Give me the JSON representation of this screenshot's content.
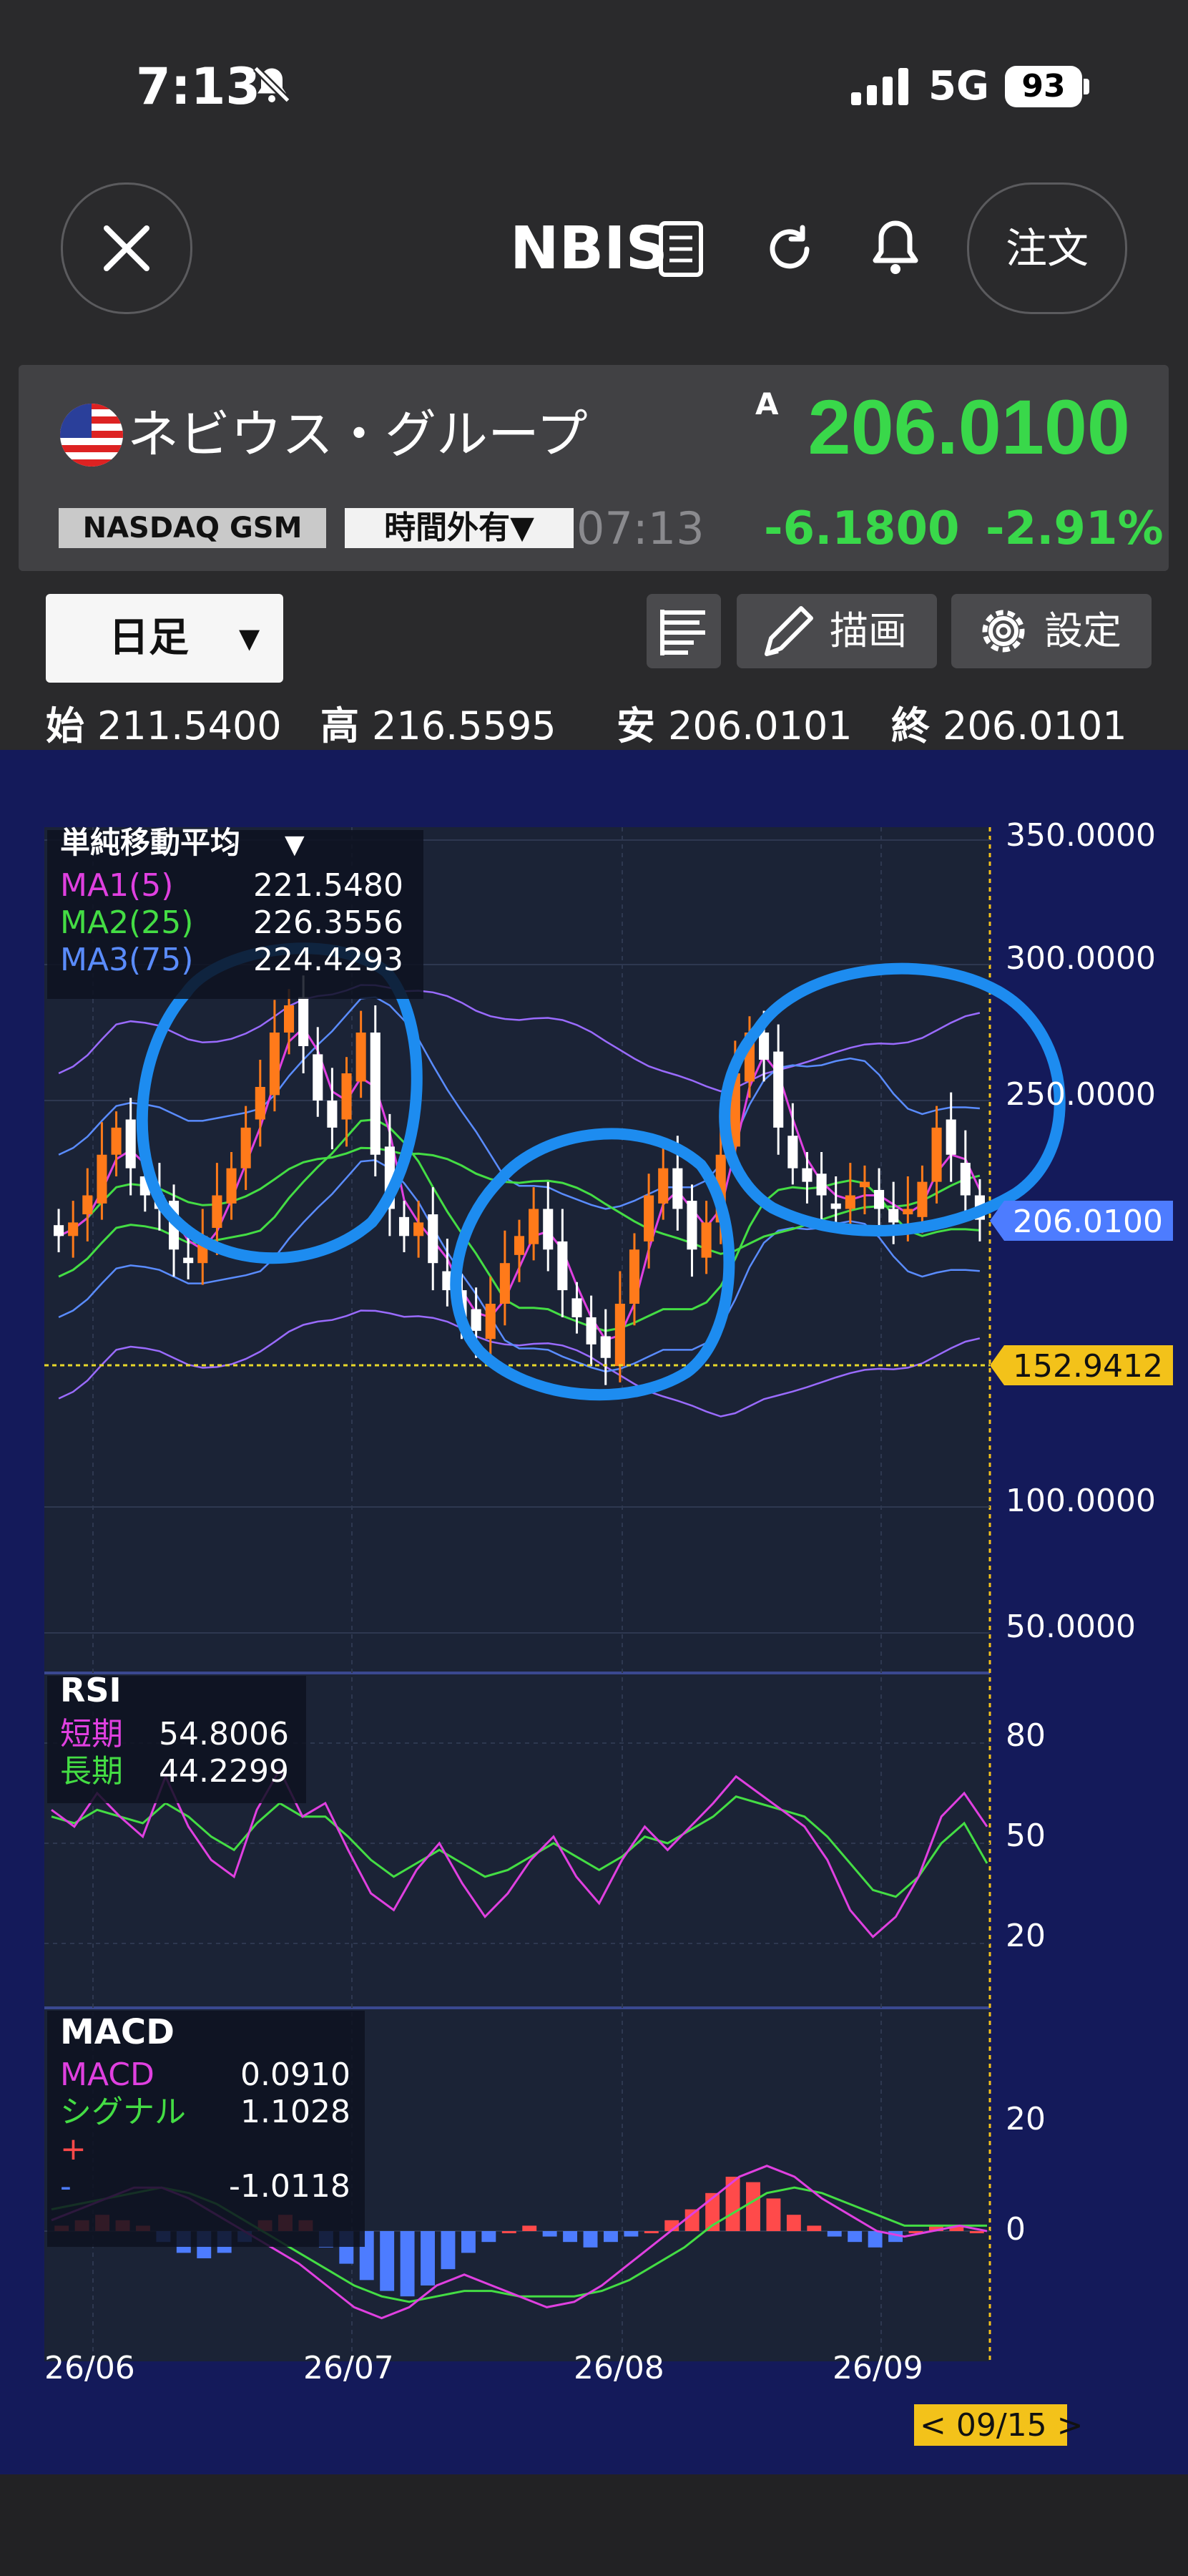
{
  "status_bar": {
    "time": "7:13",
    "network": "5G",
    "battery": "93"
  },
  "nav": {
    "ticker": "NBIS",
    "order_label": "注文"
  },
  "quote": {
    "company_name": "ネビウス・グループ",
    "price_flag": "A",
    "price": "206.0100",
    "exchange": "NASDAQ GSM",
    "session": "時間外有",
    "time": "07:13",
    "change": "-6.1800",
    "change_pct": "-2.91%"
  },
  "toolbar": {
    "period": "日足",
    "draw_label": "描画",
    "settings_label": "設定"
  },
  "ohlc": {
    "open_label": "始",
    "open": "211.5400",
    "high_label": "高",
    "high": "216.5595",
    "low_label": "安",
    "low": "206.0101",
    "close_label": "終",
    "close": "206.0101"
  },
  "price_panel": {
    "title": "単純移動平均",
    "ma": [
      {
        "name": "MA1(5)",
        "value": "221.5480",
        "color": "#e040e0"
      },
      {
        "name": "MA2(25)",
        "value": "226.3556",
        "color": "#44dd44"
      },
      {
        "name": "MA3(75)",
        "value": "224.4293",
        "color": "#5a8cff"
      }
    ],
    "axis_labels": [
      "350.0000",
      "300.0000",
      "250.0000",
      "100.0000",
      "50.0000"
    ],
    "current_price_tag": "206.0100",
    "reference_price_tag": "152.9412"
  },
  "rsi_panel": {
    "title": "RSI",
    "short_label": "短期",
    "short_value": "54.8006",
    "long_label": "長期",
    "long_value": "44.2299",
    "axis_labels": [
      "80",
      "50",
      "20"
    ]
  },
  "macd_panel": {
    "title": "MACD",
    "macd_label": "MACD",
    "macd_value": "0.0910",
    "signal_label": "シグナル",
    "signal_value": "1.1028",
    "plus_label": "+",
    "minus_label": "-",
    "hist_value": "-1.0118",
    "axis_labels": [
      "20",
      "0"
    ]
  },
  "x_axis": {
    "labels": [
      "26/06",
      "26/07",
      "26/08",
      "26/09"
    ],
    "cursor_date": "< 09/15 >"
  },
  "chart_data": {
    "type": "candlestick",
    "y_range": [
      50,
      350
    ],
    "candles_close_approx": [
      200,
      205,
      215,
      230,
      240,
      225,
      215,
      210,
      195,
      190,
      200,
      215,
      225,
      240,
      255,
      275,
      285,
      270,
      250,
      240,
      260,
      275,
      230,
      210,
      200,
      205,
      190,
      180,
      170,
      165,
      175,
      190,
      200,
      210,
      195,
      180,
      170,
      160,
      155,
      175,
      195,
      215,
      225,
      210,
      195,
      205,
      230,
      260,
      275,
      265,
      240,
      225,
      220,
      215,
      210,
      215,
      220,
      210,
      205,
      210,
      220,
      240,
      230,
      215,
      206
    ],
    "colors": {
      "up": "#ff7a1a",
      "down": "#ffffff",
      "ma1": "#e040e0",
      "ma2": "#44dd44",
      "ma3": "#5a8cff",
      "bollinger": "#9a6bff"
    },
    "rsi_short": [
      60,
      55,
      65,
      58,
      52,
      70,
      55,
      45,
      40,
      60,
      72,
      58,
      62,
      48,
      35,
      30,
      42,
      50,
      38,
      28,
      35,
      45,
      52,
      40,
      32,
      45,
      55,
      48,
      55,
      62,
      70,
      65,
      60,
      55,
      45,
      30,
      22,
      28,
      40,
      58,
      65,
      55
    ],
    "rsi_long": [
      58,
      56,
      60,
      58,
      56,
      62,
      58,
      52,
      48,
      56,
      62,
      58,
      58,
      52,
      45,
      40,
      44,
      48,
      44,
      40,
      42,
      46,
      50,
      46,
      42,
      46,
      52,
      50,
      54,
      58,
      64,
      62,
      60,
      58,
      52,
      44,
      36,
      34,
      40,
      50,
      56,
      44
    ],
    "macd_hist": [
      1,
      2,
      3,
      2,
      1,
      -2,
      -4,
      -5,
      -4,
      -2,
      2,
      3,
      2,
      -3,
      -6,
      -9,
      -11,
      -12,
      -10,
      -7,
      -4,
      -2,
      0,
      1,
      -1,
      -2,
      -3,
      -2,
      -1,
      0,
      2,
      4,
      7,
      10,
      9,
      6,
      3,
      1,
      -1,
      -2,
      -3,
      -2,
      0,
      1,
      1,
      0
    ],
    "macd_line": [
      2,
      4,
      6,
      8,
      8,
      6,
      3,
      0,
      -3,
      -6,
      -10,
      -14,
      -16,
      -14,
      -10,
      -8,
      -10,
      -12,
      -14,
      -13,
      -10,
      -6,
      -2,
      2,
      6,
      10,
      12,
      10,
      6,
      3,
      0,
      -1,
      0,
      1,
      0
    ],
    "signal_line": [
      4,
      5,
      6,
      7,
      8,
      7,
      5,
      2,
      -1,
      -4,
      -7,
      -10,
      -12,
      -13,
      -12,
      -11,
      -11,
      -12,
      -12,
      -12,
      -11,
      -9,
      -6,
      -3,
      1,
      4,
      7,
      8,
      7,
      5,
      3,
      1,
      1,
      1,
      1
    ]
  }
}
